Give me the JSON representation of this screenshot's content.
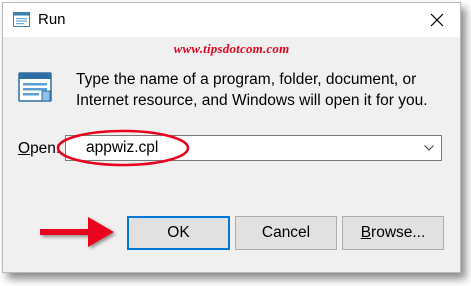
{
  "window": {
    "title": "Run",
    "close_icon": "close-icon"
  },
  "watermark": "www.tipsdotcom.com",
  "description": "Type the name of a program, folder, document, or Internet resource, and Windows will open it for you.",
  "open": {
    "label_first": "O",
    "label_rest": "pen:",
    "value": "appwiz.cpl"
  },
  "buttons": {
    "ok": "OK",
    "cancel": "Cancel",
    "browse_first": "B",
    "browse_rest": "rowse..."
  },
  "colors": {
    "annotation_red": "#e8001c",
    "focus_blue": "#0078d7"
  }
}
